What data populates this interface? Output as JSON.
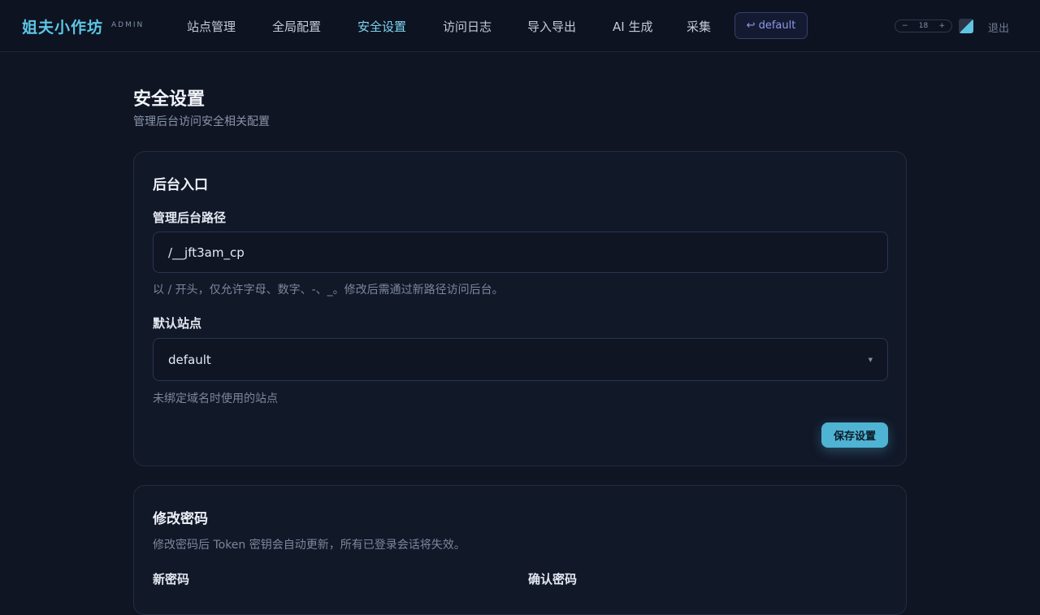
{
  "header": {
    "brand": "姐夫小作坊",
    "brand_sub": "ADMIN",
    "nav": [
      {
        "label": "站点管理"
      },
      {
        "label": "全局配置"
      },
      {
        "label": "安全设置"
      },
      {
        "label": "访问日志"
      },
      {
        "label": "导入导出"
      },
      {
        "label": "AI 生成"
      },
      {
        "label": "采集"
      }
    ],
    "active_nav": "安全设置",
    "site_chip": {
      "icon": "return-arrow-icon",
      "glyph": "↩",
      "label": "default"
    },
    "font_size": {
      "minus": "−",
      "value": "18",
      "plus": "+"
    },
    "theme_toggle_icon": "theme-toggle-icon",
    "logout": "退出"
  },
  "page": {
    "title": "安全设置",
    "subtitle": "管理后台访问安全相关配置"
  },
  "card_entry": {
    "title": "后台入口",
    "path_label": "管理后台路径",
    "path_value": "/__jft3am_cp",
    "path_hint": "以 / 开头，仅允许字母、数字、-、_。修改后需通过新路径访问后台。",
    "site_label": "默认站点",
    "site_value": "default",
    "site_hint": "未绑定域名时使用的站点",
    "save_label": "保存设置"
  },
  "card_password": {
    "title": "修改密码",
    "desc": "修改密码后 Token 密钥会自动更新，所有已登录会话将失效。",
    "new_label": "新密码",
    "confirm_label": "确认密码"
  },
  "colors": {
    "background": "#0f1523",
    "accent": "#4fb3d3",
    "brand": "#5ec6e4",
    "active_nav": "#7fd4ef"
  }
}
